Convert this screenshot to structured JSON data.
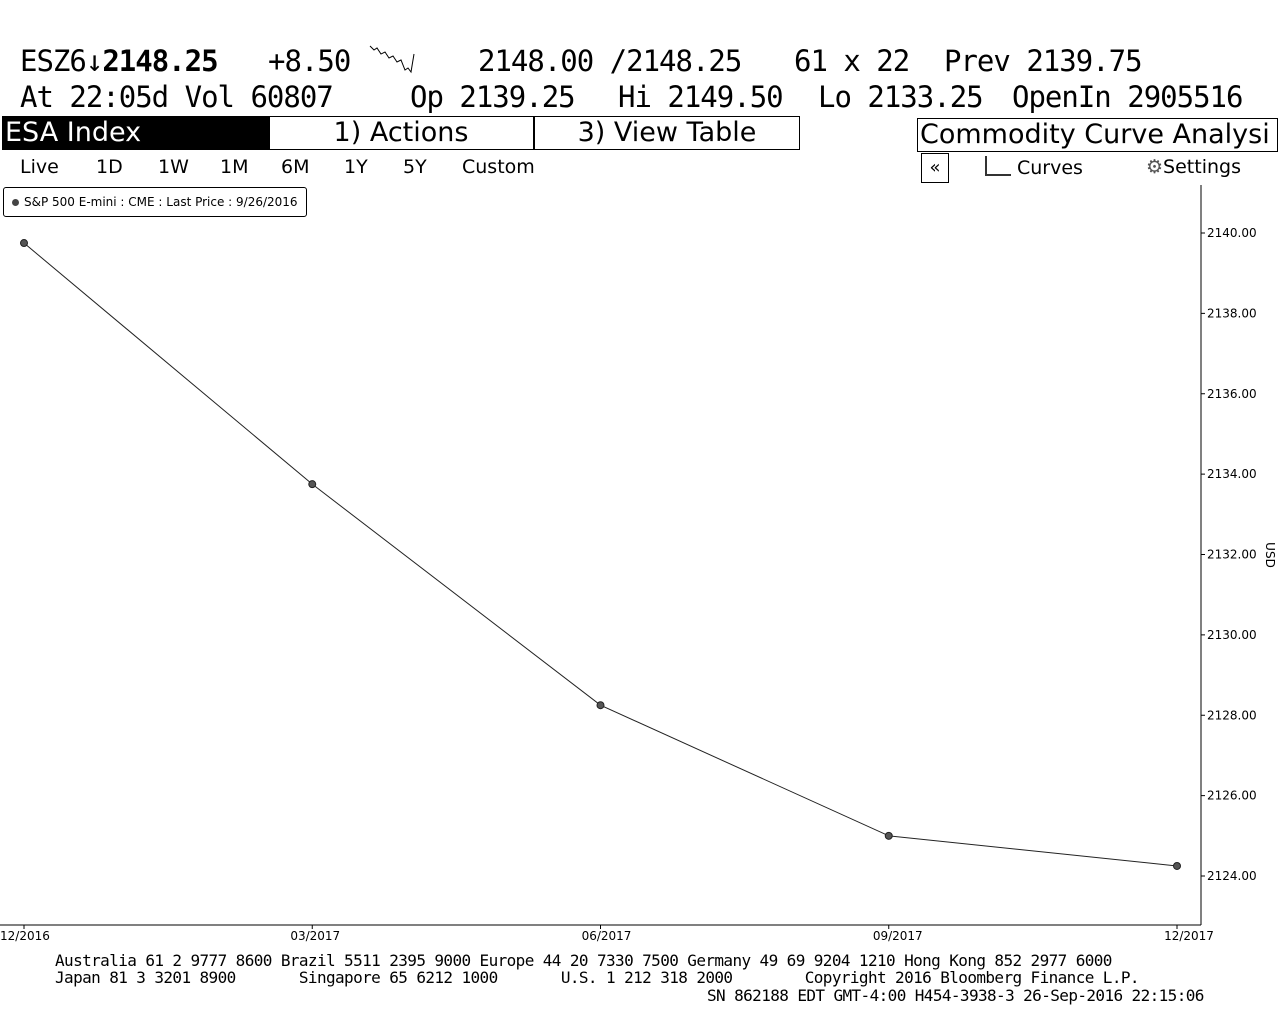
{
  "quote": {
    "ticker": "ESZ6",
    "direction_icon": "down-arrow",
    "last": "2148.25",
    "change": "+8.50",
    "bid_ask": "2148.00 /2148.25",
    "size": "61 x 22",
    "prev_label": "Prev",
    "prev": "2139.75",
    "time": "At 22:05d",
    "vol_label": "Vol",
    "vol": "60807",
    "op_label": "Op",
    "op": "2139.25",
    "hi_label": "Hi",
    "hi": "2149.50",
    "lo_label": "Lo",
    "lo": "2133.25",
    "oi_label": "OpenIn",
    "oi": "2905516"
  },
  "toolbar": {
    "security": "ESA Index",
    "actions": "1) Actions",
    "view_table": "3) View Table",
    "title": "Commodity Curve Analysi",
    "collapse": "«",
    "curves": "Curves",
    "settings": "Settings"
  },
  "periods": [
    "Live",
    "1D",
    "1W",
    "1M",
    "6M",
    "1Y",
    "5Y",
    "Custom"
  ],
  "chart_data": {
    "type": "line",
    "legend": "S&P 500 E-mini : CME : Last Price : 9/26/2016",
    "categories": [
      "12/2016",
      "03/2017",
      "06/2017",
      "09/2017",
      "12/2017"
    ],
    "values": [
      2139.75,
      2133.75,
      2128.25,
      2125.0,
      2124.25
    ],
    "ylabel": "USD",
    "yticks": [
      "2140.00",
      "2138.00",
      "2136.00",
      "2134.00",
      "2132.00",
      "2130.00",
      "2128.00",
      "2126.00",
      "2124.00"
    ],
    "ylim": [
      2122.8,
      2141.3
    ]
  },
  "footer": {
    "line1": "Australia 61 2 9777 8600 Brazil 5511 2395 9000 Europe 44 20 7330 7500 Germany 49 69 9204 1210 Hong Kong 852 2977 6000",
    "line2": "Japan 81 3 3201 8900       Singapore 65 6212 1000       U.S. 1 212 318 2000        Copyright 2016 Bloomberg Finance L.P.",
    "line3": "SN 862188 EDT  GMT-4:00 H454-3938-3 26-Sep-2016 22:15:06"
  }
}
